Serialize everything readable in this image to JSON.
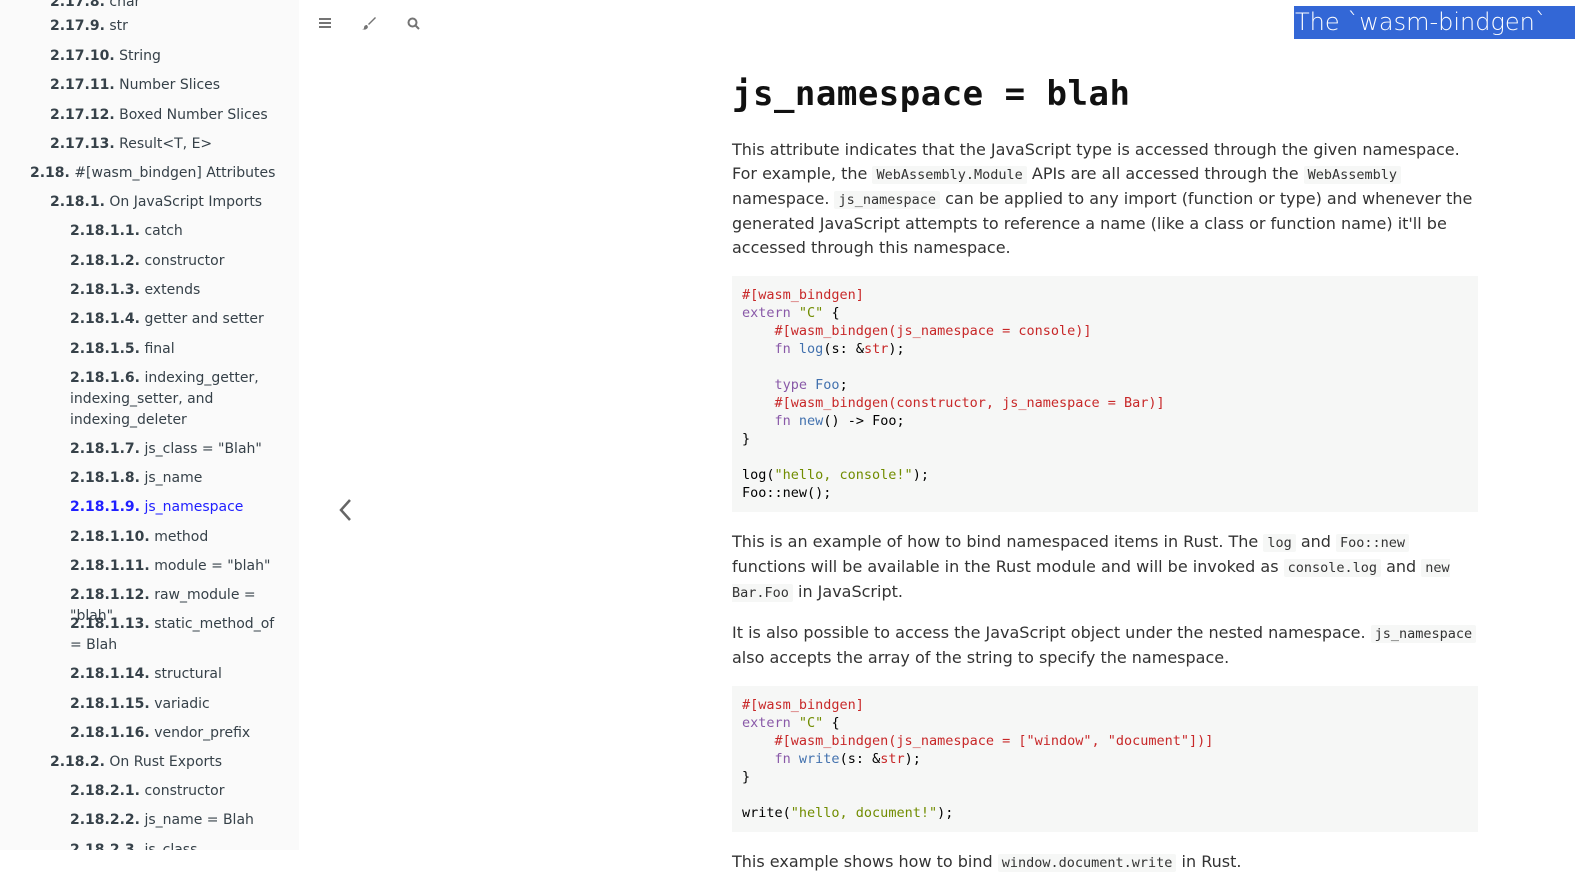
{
  "sidebar": {
    "items": [
      {
        "num": "2.17.8.",
        "label": "char"
      },
      {
        "num": "2.17.9.",
        "label": "str"
      },
      {
        "num": "2.17.10.",
        "label": "String"
      },
      {
        "num": "2.17.11.",
        "label": "Number Slices"
      },
      {
        "num": "2.17.12.",
        "label": "Boxed Number Slices"
      },
      {
        "num": "2.17.13.",
        "label": "Result<T, E>"
      },
      {
        "num": "2.18.",
        "label": "#[wasm_bindgen] Attributes"
      },
      {
        "num": "2.18.1.",
        "label": "On JavaScript Imports"
      },
      {
        "num": "2.18.1.1.",
        "label": "catch"
      },
      {
        "num": "2.18.1.2.",
        "label": "constructor"
      },
      {
        "num": "2.18.1.3.",
        "label": "extends"
      },
      {
        "num": "2.18.1.4.",
        "label": "getter and setter"
      },
      {
        "num": "2.18.1.5.",
        "label": "final"
      },
      {
        "num": "2.18.1.6.",
        "label": "indexing_getter, indexing_setter, and indexing_deleter"
      },
      {
        "num": "2.18.1.7.",
        "label": "js_class = \"Blah\""
      },
      {
        "num": "2.18.1.8.",
        "label": "js_name"
      },
      {
        "num": "2.18.1.9.",
        "label": "js_namespace"
      },
      {
        "num": "2.18.1.10.",
        "label": "method"
      },
      {
        "num": "2.18.1.11.",
        "label": "module = \"blah\""
      },
      {
        "num": "2.18.1.12.",
        "label": "raw_module = \"blah\""
      },
      {
        "num": "2.18.1.13.",
        "label": "static_method_of = Blah"
      },
      {
        "num": "2.18.1.14.",
        "label": "structural"
      },
      {
        "num": "2.18.1.15.",
        "label": "variadic"
      },
      {
        "num": "2.18.1.16.",
        "label": "vendor_prefix"
      },
      {
        "num": "2.18.2.",
        "label": "On Rust Exports"
      },
      {
        "num": "2.18.2.1.",
        "label": "constructor"
      },
      {
        "num": "2.18.2.2.",
        "label": "js_name = Blah"
      },
      {
        "num": "2.18.2.3.",
        "label": "js_class"
      }
    ]
  },
  "menu": {
    "toggle_icon": "hamburger-icon",
    "theme_icon": "paintbrush-icon",
    "search_icon": "search-icon",
    "book_title": "The `wasm-bindgen` Guide"
  },
  "content": {
    "heading": "js_namespace = blah",
    "p1": {
      "t1": "This attribute indicates that the JavaScript type is accessed through the given namespace. For example, the ",
      "c1": "WebAssembly.Module",
      "t2": " APIs are all accessed through the ",
      "c2": "WebAssembly",
      "t3": " namespace. ",
      "c3": "js_namespace",
      "t4": " can be applied to any import (function or type) and whenever the generated JavaScript attempts to reference a name (like a class or function name) it'll be accessed through this namespace."
    },
    "code1": {
      "l1": "#[wasm_bindgen]",
      "l2_kw": "extern",
      "l2_str": "\"C\"",
      "l2_rest": " {",
      "l3": "#[wasm_bindgen(js_namespace = console)]",
      "l4_kw": "fn",
      "l4_name": "log",
      "l4_a": "(s: &",
      "l4_ty": "str",
      "l4_b": ");",
      "l6_kw": "type",
      "l6_name": "Foo",
      "l6_b": ";",
      "l7": "#[wasm_bindgen(constructor, js_namespace = Bar)]",
      "l8_kw": "fn",
      "l8_name": "new",
      "l8_b": "() -> Foo;",
      "l9": "}",
      "l11_a": "log(",
      "l11_str": "\"hello, console!\"",
      "l11_b": ");",
      "l12": "Foo::new();"
    },
    "p2": {
      "t1": "This is an example of how to bind namespaced items in Rust. The ",
      "c1": "log",
      "t2": " and ",
      "c2": "Foo::new",
      "t3": " functions will be available in the Rust module and will be invoked as ",
      "c3": "console.log",
      "t4": " and ",
      "c4": "new Bar.Foo",
      "t5": " in JavaScript."
    },
    "p3": {
      "t1": "It is also possible to access the JavaScript object under the nested namespace. ",
      "c1": "js_namespace",
      "t2": " also accepts the array of the string to specify the namespace."
    },
    "code2": {
      "l1": "#[wasm_bindgen]",
      "l2_kw": "extern",
      "l2_str": "\"C\"",
      "l2_rest": " {",
      "l3": "#[wasm_bindgen(js_namespace = [\"window\", \"document\"])]",
      "l4_kw": "fn",
      "l4_name": "write",
      "l4_a": "(s: &",
      "l4_ty": "str",
      "l4_b": ");",
      "l5": "}",
      "l7_a": "write(",
      "l7_str": "\"hello, document!\"",
      "l7_b": ");"
    },
    "p4": {
      "t1": "This example shows how to bind ",
      "c1": "window.document.write",
      "t2": " in Rust."
    }
  },
  "nav": {
    "prev_icon": "chevron-left-icon"
  },
  "colors": {
    "title_bg": "#3367d6",
    "active_link": "#1f1fff",
    "sidebar_bg": "#fafafa",
    "code_bg": "#f6f7f6"
  }
}
